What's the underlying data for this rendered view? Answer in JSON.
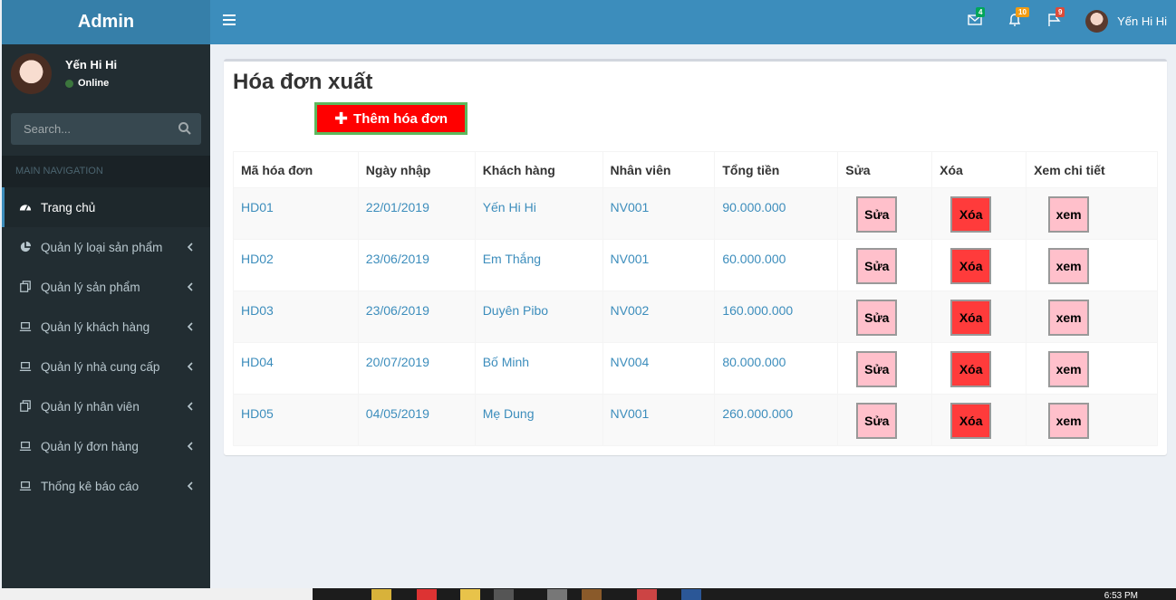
{
  "header": {
    "brand": "Admin",
    "mail_badge": "4",
    "bell_badge": "10",
    "flag_badge": "9",
    "user_name": "Yến Hi Hi",
    "colors": {
      "mail_badge": "#00a65a",
      "bell_badge": "#f39c12",
      "flag_badge": "#dd4b39"
    }
  },
  "sidebar": {
    "user_name": "Yến Hi Hi",
    "status": "Online",
    "search_placeholder": "Search...",
    "nav_header": "MAIN NAVIGATION",
    "items": [
      {
        "label": "Trang chủ",
        "icon": "dashboard-icon",
        "active": true
      },
      {
        "label": "Quản lý loại sản phẩm",
        "icon": "pie-chart-icon"
      },
      {
        "label": "Quản lý sản phẩm",
        "icon": "copy-icon"
      },
      {
        "label": "Quản lý khách hàng",
        "icon": "laptop-icon"
      },
      {
        "label": "Quản lý nhà cung cấp",
        "icon": "laptop-icon"
      },
      {
        "label": "Quản lý nhân viên",
        "icon": "copy-icon"
      },
      {
        "label": "Quản lý đơn hàng",
        "icon": "laptop-icon"
      },
      {
        "label": "Thống kê báo cáo",
        "icon": "laptop-icon"
      }
    ]
  },
  "main": {
    "title": "Hóa đơn xuất",
    "add_button": "Thêm hóa đơn",
    "table": {
      "headers": [
        "Mã hóa đơn",
        "Ngày nhập",
        "Khách hàng",
        "Nhân viên",
        "Tổng tiền",
        "Sửa",
        "Xóa",
        "Xem chi tiết"
      ],
      "rows": [
        {
          "id": "HD01",
          "date": "22/01/2019",
          "customer": "Yến Hi Hi",
          "staff": "NV001",
          "total": "90.000.000"
        },
        {
          "id": "HD02",
          "date": "23/06/2019",
          "customer": "Em Thắng",
          "staff": "NV001",
          "total": "60.000.000"
        },
        {
          "id": "HD03",
          "date": "23/06/2019",
          "customer": "Duyên Pibo",
          "staff": "NV002",
          "total": "160.000.000"
        },
        {
          "id": "HD04",
          "date": "20/07/2019",
          "customer": "Bố Minh",
          "staff": "NV004",
          "total": "80.000.000"
        },
        {
          "id": "HD05",
          "date": "04/05/2019",
          "customer": "Mẹ Dung",
          "staff": "NV001",
          "total": "260.000.000"
        }
      ],
      "edit_label": "Sửa",
      "delete_label": "Xóa",
      "view_label": "xem"
    }
  },
  "taskbar": {
    "clock": "6:53 PM"
  }
}
